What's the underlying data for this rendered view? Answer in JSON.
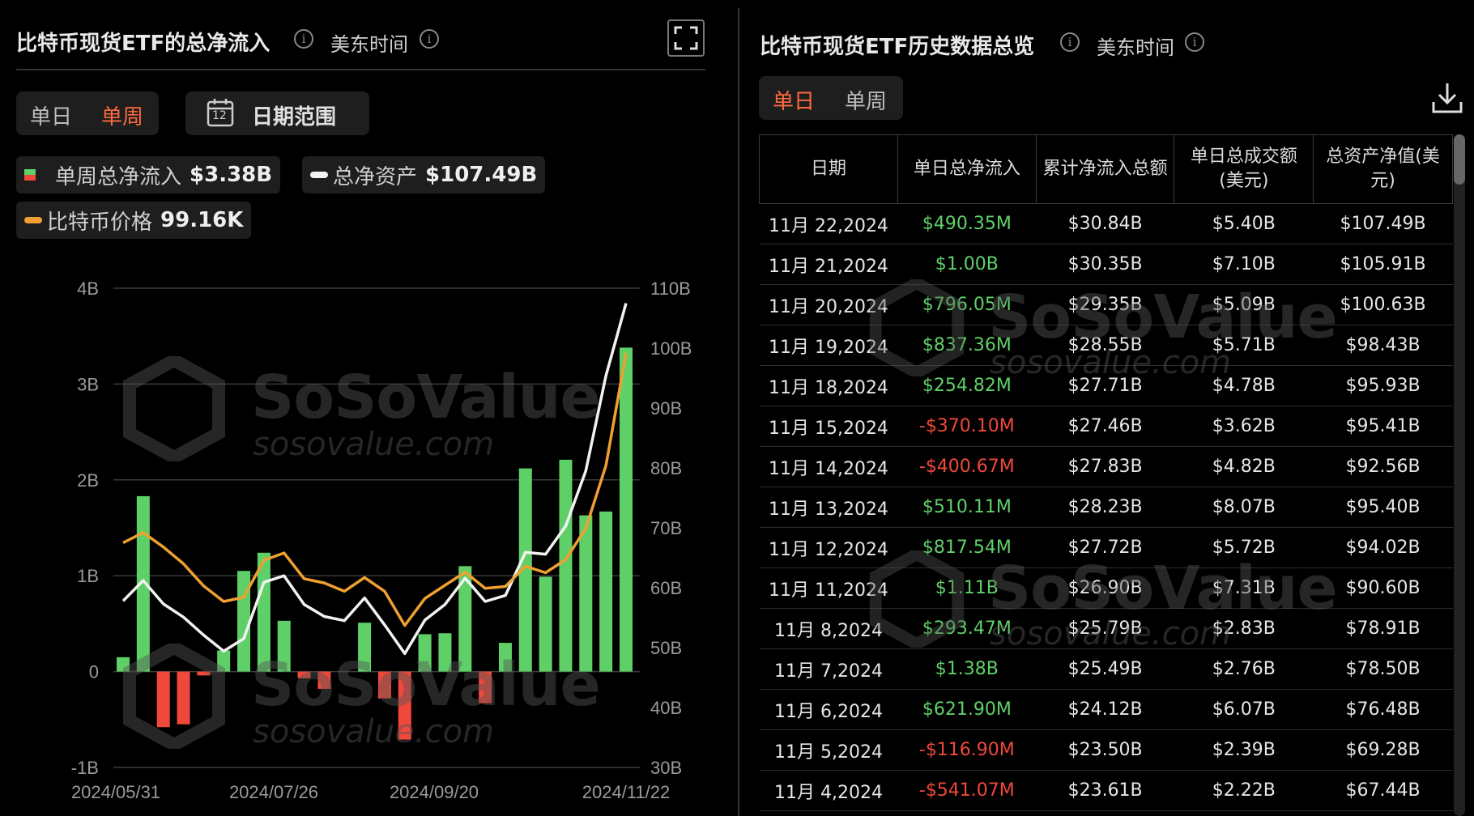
{
  "left": {
    "title": "比特币现货ETF的总净流入",
    "timezone": "美东时间",
    "tabs": [
      "单日",
      "单周"
    ],
    "active_tab": "单周",
    "date_range_label": "日期范围",
    "calendar_day": "12",
    "legend": {
      "weekly_inflow_label": "单周总净流入",
      "weekly_inflow_value": "$3.38B",
      "net_assets_label": "总净资产",
      "net_assets_value": "$107.49B",
      "btc_price_label": "比特币价格",
      "btc_price_value": "99.16K"
    },
    "watermark": {
      "brand": "SoSoValue",
      "url": "sosovalue.com"
    }
  },
  "right": {
    "title": "比特币现货ETF历史数据总览",
    "timezone": "美东时间",
    "tabs": [
      "单日",
      "单周"
    ],
    "active_tab": "单日",
    "headers": [
      "日期",
      "单日总净流入",
      "累计净流入总额",
      "单日总成交额(美元)",
      "总资产净值(美元)"
    ],
    "rows": [
      [
        "11月 22,2024",
        "$490.35M",
        "$30.84B",
        "$5.40B",
        "$107.49B"
      ],
      [
        "11月 21,2024",
        "$1.00B",
        "$30.35B",
        "$7.10B",
        "$105.91B"
      ],
      [
        "11月 20,2024",
        "$796.05M",
        "$29.35B",
        "$5.09B",
        "$100.63B"
      ],
      [
        "11月 19,2024",
        "$837.36M",
        "$28.55B",
        "$5.71B",
        "$98.43B"
      ],
      [
        "11月 18,2024",
        "$254.82M",
        "$27.71B",
        "$4.78B",
        "$95.93B"
      ],
      [
        "11月 15,2024",
        "-$370.10M",
        "$27.46B",
        "$3.62B",
        "$95.41B"
      ],
      [
        "11月 14,2024",
        "-$400.67M",
        "$27.83B",
        "$4.82B",
        "$92.56B"
      ],
      [
        "11月 13,2024",
        "$510.11M",
        "$28.23B",
        "$8.07B",
        "$95.40B"
      ],
      [
        "11月 12,2024",
        "$817.54M",
        "$27.72B",
        "$5.72B",
        "$94.02B"
      ],
      [
        "11月 11,2024",
        "$1.11B",
        "$26.90B",
        "$7.31B",
        "$90.60B"
      ],
      [
        "11月 8,2024",
        "$293.47M",
        "$25.79B",
        "$2.83B",
        "$78.91B"
      ],
      [
        "11月 7,2024",
        "$1.38B",
        "$25.49B",
        "$2.76B",
        "$78.50B"
      ],
      [
        "11月 6,2024",
        "$621.90M",
        "$24.12B",
        "$6.07B",
        "$76.48B"
      ],
      [
        "11月 5,2024",
        "-$116.90M",
        "$23.50B",
        "$2.39B",
        "$69.28B"
      ],
      [
        "11月 4,2024",
        "-$541.07M",
        "$23.61B",
        "$2.22B",
        "$67.44B"
      ]
    ],
    "watermark": {
      "brand": "SoSoValue",
      "url": "sosovalue.com"
    }
  },
  "colors": {
    "positive": "#5fd068",
    "negative": "#f0483b",
    "accent": "#ff6a3d",
    "net_assets_line": "#f2f2f2",
    "btc_line": "#f0a030"
  },
  "icons": [
    "info-icon",
    "expand-icon",
    "calendar-icon",
    "download-icon"
  ],
  "chart_data": {
    "type": "bar",
    "x_tick_labels": [
      "2024/05/31",
      "2024/07/26",
      "2024/09/20",
      "2024/11/22"
    ],
    "y_left_ticks": [
      "4B",
      "3B",
      "2B",
      "1B",
      "0",
      "-1B"
    ],
    "y_right_ticks": [
      "110B",
      "100B",
      "90B",
      "80B",
      "70B",
      "60B",
      "50B",
      "40B",
      "30B"
    ],
    "ylim_left": [
      -1,
      4
    ],
    "ylim_right": [
      30,
      110
    ],
    "series": [
      {
        "name": "单周总净流入",
        "unit": "B",
        "values": [
          0.15,
          1.83,
          -0.58,
          -0.55,
          -0.04,
          0.22,
          1.05,
          1.24,
          0.53,
          -0.07,
          -0.18,
          0.0,
          0.51,
          -0.28,
          -0.71,
          0.39,
          0.4,
          1.1,
          -0.33,
          0.3,
          2.12,
          0.99,
          2.21,
          1.63,
          1.67,
          3.38
        ]
      },
      {
        "name": "总净资产",
        "unit": "B",
        "values": [
          57.8,
          61.2,
          57.3,
          55.1,
          52.1,
          49.4,
          51.5,
          60.9,
          62.0,
          57.2,
          55.2,
          54.5,
          58.3,
          53.8,
          49.0,
          54.6,
          57.2,
          61.6,
          57.7,
          58.7,
          65.9,
          65.6,
          70.3,
          79.5,
          95.4,
          107.49
        ]
      },
      {
        "name": "比特币价格",
        "unit": "K",
        "values": [
          67.5,
          69.2,
          66.8,
          64.0,
          60.3,
          57.7,
          58.4,
          64.6,
          65.8,
          61.5,
          60.8,
          59.4,
          61.7,
          59.4,
          53.7,
          58.2,
          60.4,
          62.6,
          59.9,
          60.2,
          63.6,
          62.5,
          64.7,
          69.9,
          80.4,
          99.16
        ]
      }
    ]
  }
}
